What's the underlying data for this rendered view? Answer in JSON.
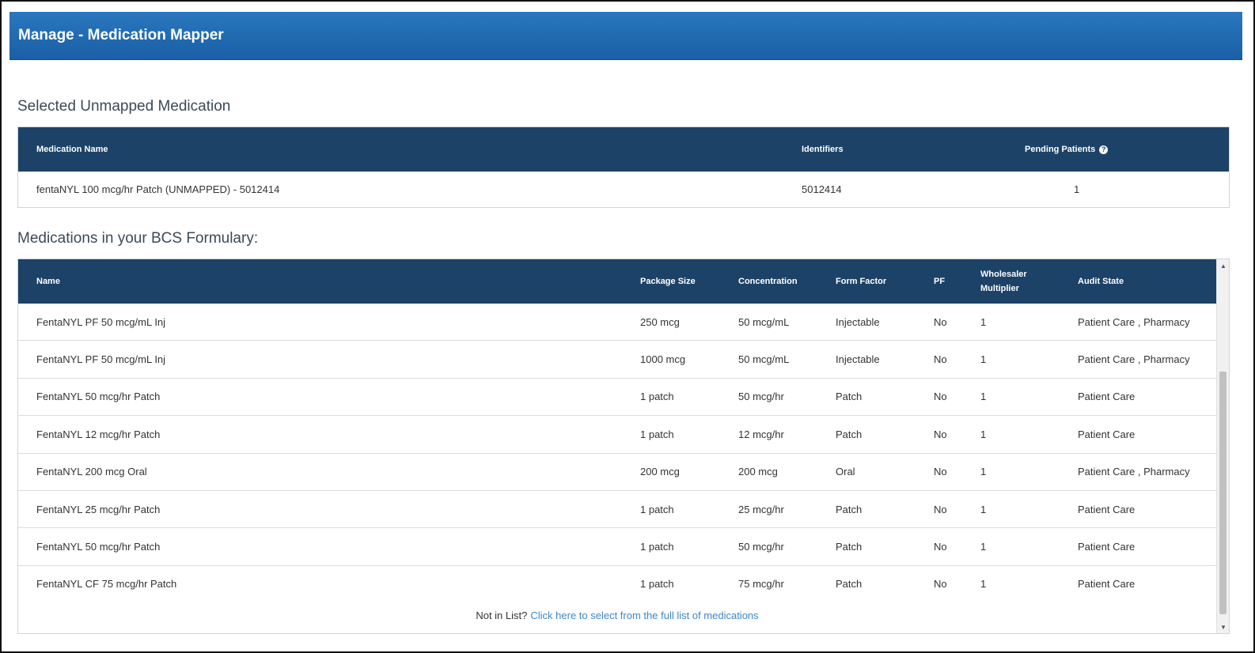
{
  "header": {
    "title": "Manage - Medication Mapper"
  },
  "unmapped": {
    "heading": "Selected Unmapped Medication",
    "columns": {
      "name": "Medication Name",
      "identifiers": "Identifiers",
      "pending": "Pending Patients"
    },
    "row": {
      "name": "fentaNYL 100 mcg/hr Patch (UNMAPPED) - 5012414",
      "identifiers": "5012414",
      "pending": "1"
    }
  },
  "formulary": {
    "heading": "Medications in your BCS Formulary:",
    "columns": {
      "name": "Name",
      "package_size": "Package Size",
      "concentration": "Concentration",
      "form_factor": "Form Factor",
      "pf": "PF",
      "wholesaler_1": "Wholesaler",
      "wholesaler_2": "Multiplier",
      "audit_state": "Audit State"
    },
    "rows": [
      {
        "name": "FentaNYL PF 50 mcg/mL Inj",
        "package_size": "250 mcg",
        "concentration": "50 mcg/mL",
        "form_factor": "Injectable",
        "pf": "No",
        "multiplier": "1",
        "audit_state": "Patient Care , Pharmacy"
      },
      {
        "name": "FentaNYL PF 50 mcg/mL Inj",
        "package_size": "1000 mcg",
        "concentration": "50 mcg/mL",
        "form_factor": "Injectable",
        "pf": "No",
        "multiplier": "1",
        "audit_state": "Patient Care , Pharmacy"
      },
      {
        "name": "FentaNYL 50 mcg/hr Patch",
        "package_size": "1 patch",
        "concentration": "50  mcg/hr",
        "form_factor": "Patch",
        "pf": "No",
        "multiplier": "1",
        "audit_state": "Patient Care"
      },
      {
        "name": "FentaNYL 12 mcg/hr Patch",
        "package_size": "1 patch",
        "concentration": "12 mcg/hr",
        "form_factor": "Patch",
        "pf": "No",
        "multiplier": "1",
        "audit_state": "Patient Care"
      },
      {
        "name": "FentaNYL 200 mcg Oral",
        "package_size": "200 mcg",
        "concentration": "200 mcg",
        "form_factor": "Oral",
        "pf": "No",
        "multiplier": "1",
        "audit_state": "Patient Care , Pharmacy"
      },
      {
        "name": "FentaNYL 25 mcg/hr Patch",
        "package_size": "1 patch",
        "concentration": "25 mcg/hr",
        "form_factor": "Patch",
        "pf": "No",
        "multiplier": "1",
        "audit_state": "Patient Care"
      },
      {
        "name": "FentaNYL 50 mcg/hr Patch",
        "package_size": "1 patch",
        "concentration": "50 mcg/hr",
        "form_factor": "Patch",
        "pf": "No",
        "multiplier": "1",
        "audit_state": "Patient Care"
      },
      {
        "name": "FentaNYL CF 75 mcg/hr Patch",
        "package_size": "1 patch",
        "concentration": "75 mcg/hr",
        "form_factor": "Patch",
        "pf": "No",
        "multiplier": "1",
        "audit_state": "Patient Care"
      }
    ],
    "footer": {
      "prompt": "Not in List?",
      "link": "Click here to select from the full list of medications"
    }
  },
  "icons": {
    "help": "question-circle-icon",
    "scroll_up": "scroll-up-arrow-icon",
    "scroll_down": "scroll-down-arrow-icon"
  }
}
